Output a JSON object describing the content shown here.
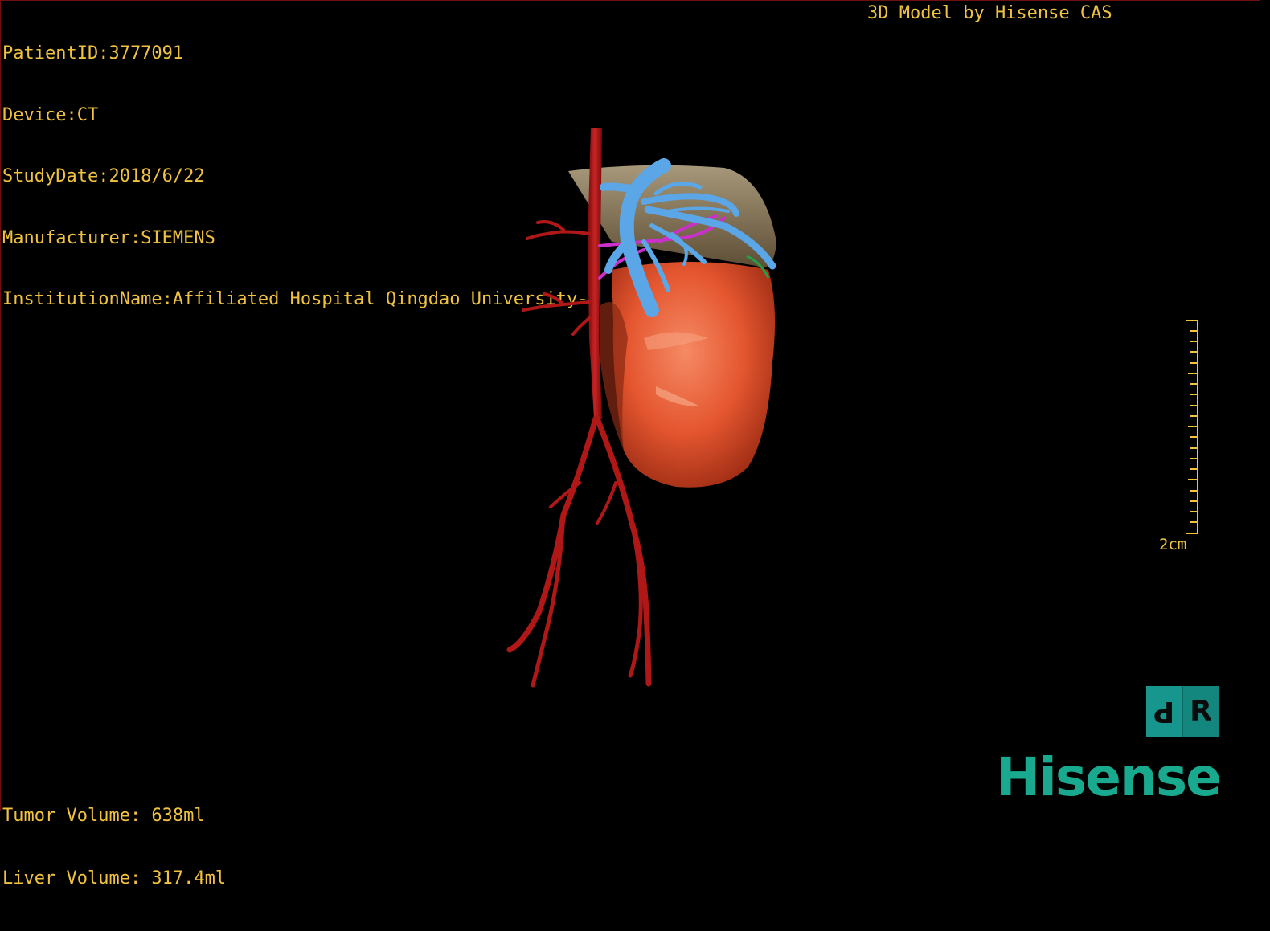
{
  "overlay": {
    "patient_id": "PatientID:3777091",
    "device": "Device:CT",
    "study_date": "StudyDate:2018/6/22",
    "manufacturer": "Manufacturer:SIEMENS",
    "institution": "InstitutionName:Affiliated Hospital Qingdao University-C",
    "brand_text": "3D Model by Hisense CAS"
  },
  "volumes": {
    "tumor": "Tumor Volume: 638ml",
    "liver": "Liver Volume: 317.4ml"
  },
  "scale_bar": {
    "label": "2cm"
  },
  "orientation_cube": {
    "left_face": "P",
    "right_face": "R"
  },
  "logo": {
    "text": "Hisense",
    "color": "#19a98f"
  },
  "colors": {
    "overlay_text": "#f0c240",
    "artery": "#b01818",
    "portal_vein": "#5aa6e6",
    "tumor": "#e85a38",
    "liver": "#8a7a5c",
    "hepatic_artery": "#d030d0",
    "bile_duct": "#22a048"
  },
  "icons": {
    "orientation": "orientation-cube-icon",
    "scale": "scale-bar-icon"
  }
}
